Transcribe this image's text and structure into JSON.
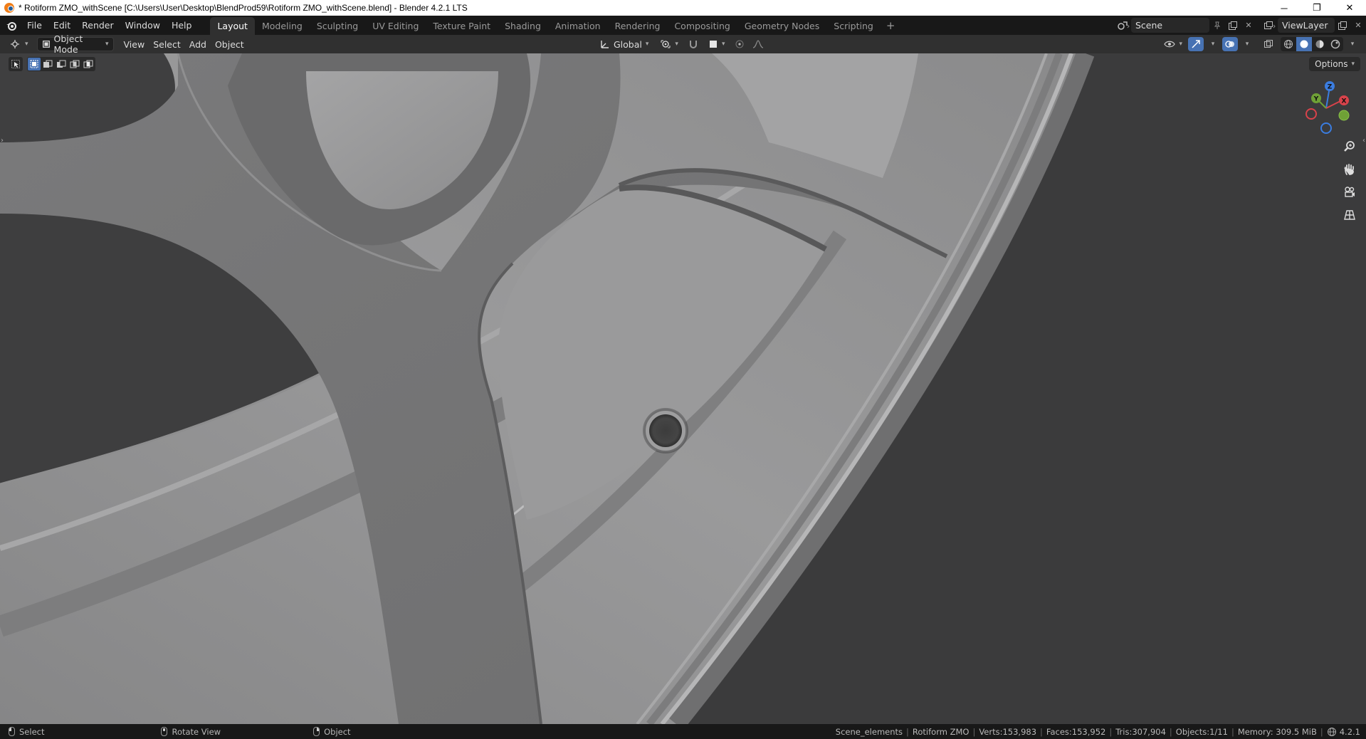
{
  "window": {
    "title": "* Rotiform ZMO_withScene [C:\\Users\\User\\Desktop\\BlendProd59\\Rotiform ZMO_withScene.blend] - Blender 4.2.1 LTS",
    "minimize": "─",
    "maximize": "❐",
    "close": "✕"
  },
  "menus": [
    "File",
    "Edit",
    "Render",
    "Window",
    "Help"
  ],
  "workspaces": [
    "Layout",
    "Modeling",
    "Sculpting",
    "UV Editing",
    "Texture Paint",
    "Shading",
    "Animation",
    "Rendering",
    "Compositing",
    "Geometry Nodes",
    "Scripting"
  ],
  "workspace_add": "+",
  "scene": {
    "name": "Scene",
    "view_layer": "ViewLayer"
  },
  "viewport_header": {
    "mode": "Object Mode",
    "menus": [
      "View",
      "Select",
      "Add",
      "Object"
    ],
    "transform_orientation": "Global",
    "options": "Options"
  },
  "gizmo": {
    "x": "X",
    "y": "Y",
    "z": "Z"
  },
  "status": {
    "select": "Select",
    "rotate": "Rotate View",
    "object": "Object",
    "collection": "Scene_elements",
    "active_object": "Rotiform ZMO",
    "verts": "Verts:153,983",
    "faces": "Faces:153,952",
    "tris": "Tris:307,904",
    "objects": "Objects:1/11",
    "memory": "Memory: 309.5 MiB",
    "version": "4.2.1"
  }
}
